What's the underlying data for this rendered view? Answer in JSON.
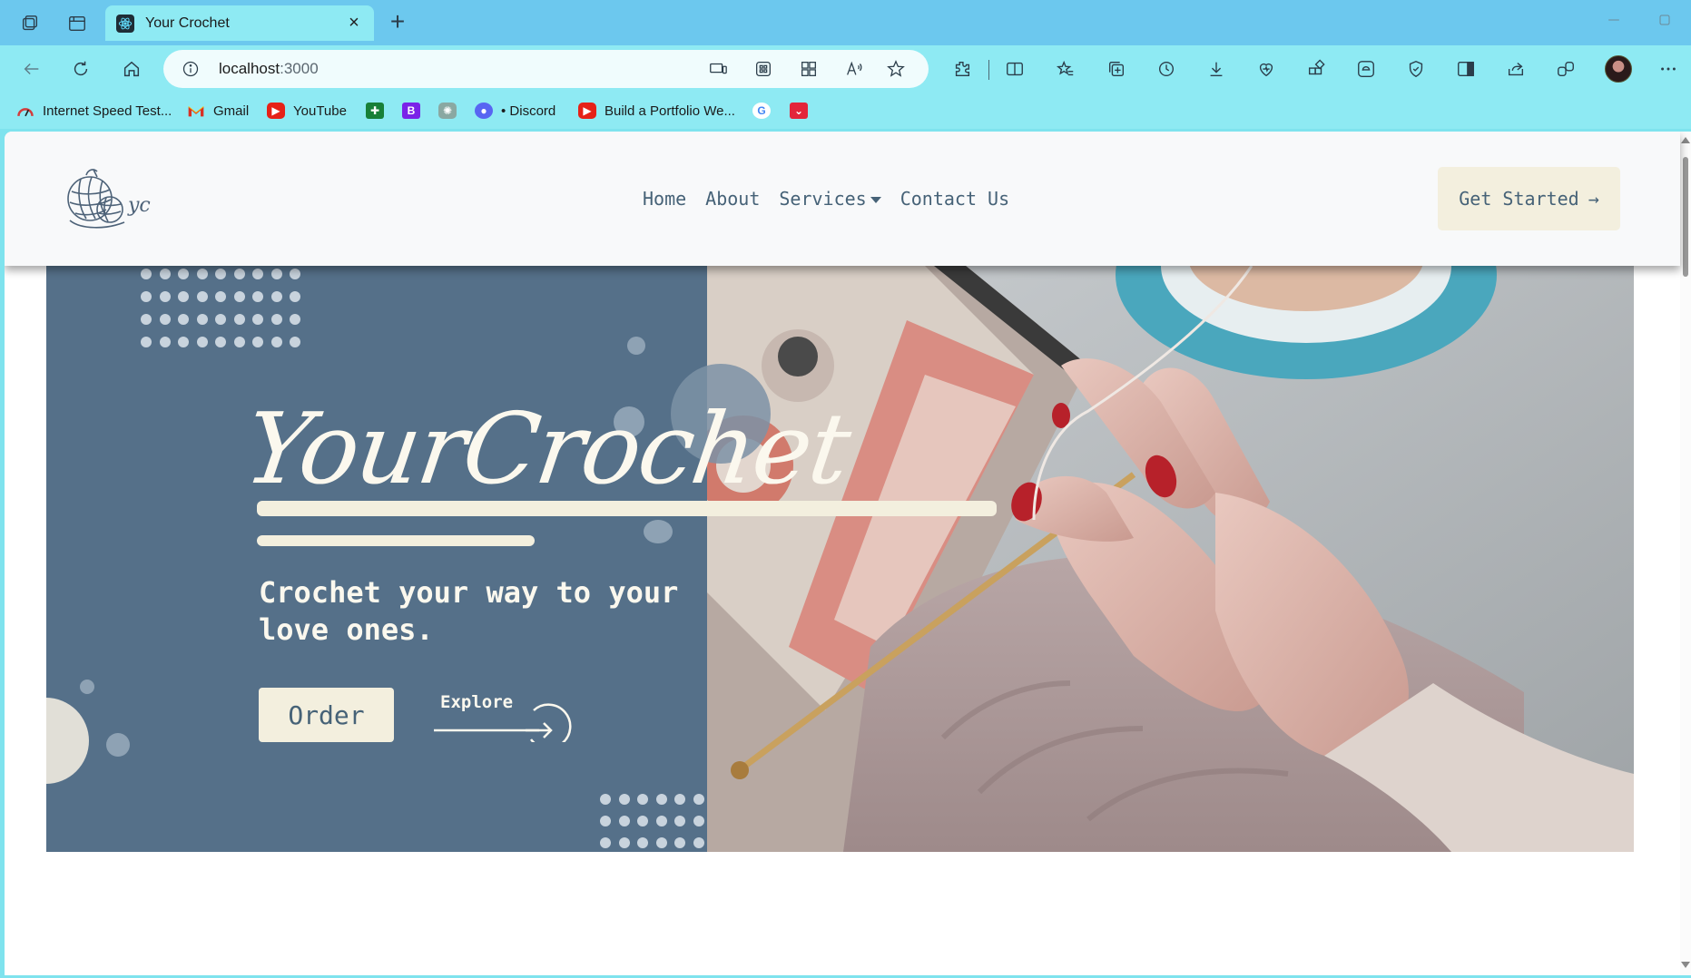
{
  "browser": {
    "tab_title": "Your Crochet",
    "tab_close": "×",
    "new_tab": "+",
    "address": {
      "host": "localhost",
      "port": ":3000"
    },
    "bookmarks": [
      {
        "label": "Internet Speed Test...",
        "icon": "speedometer-icon",
        "color": "#d33c3c"
      },
      {
        "label": "Gmail",
        "icon": "gmail-icon",
        "color": "#d93025"
      },
      {
        "label": "YouTube",
        "icon": "youtube-icon",
        "color": "#e62117"
      },
      {
        "label": "",
        "icon": "google-sheets-icon",
        "color": "#188038"
      },
      {
        "label": "",
        "icon": "bootstrap-icon",
        "color": "#7a22e8"
      },
      {
        "label": "",
        "icon": "chatgpt-icon",
        "color": "#6b8c86"
      },
      {
        "label": "• Discord",
        "icon": "discord-icon",
        "color": "#5865f2"
      },
      {
        "label": "Build a Portfolio We...",
        "icon": "youtube-icon",
        "color": "#e62117"
      },
      {
        "label": "",
        "icon": "google-icon",
        "color": "#4285f4"
      },
      {
        "label": "",
        "icon": "pocket-icon",
        "color": "#e3243a"
      }
    ]
  },
  "page": {
    "logo_text": "yc",
    "nav": {
      "home": "Home",
      "about": "About",
      "services": "Services",
      "contact": "Contact Us"
    },
    "cta": {
      "label": "Get Started",
      "arrow": "→"
    },
    "hero": {
      "title": "YourCrochet",
      "tagline": "Crochet your way to your\nlove ones.",
      "order_label": "Order",
      "explore_label": "Explore"
    }
  },
  "colors": {
    "hero_bg": "#557089",
    "cream": "#f3efde",
    "nav_text": "#466277",
    "chrome_tab_bar": "#6cc8ee",
    "chrome_toolbar": "#8eeaf3"
  }
}
